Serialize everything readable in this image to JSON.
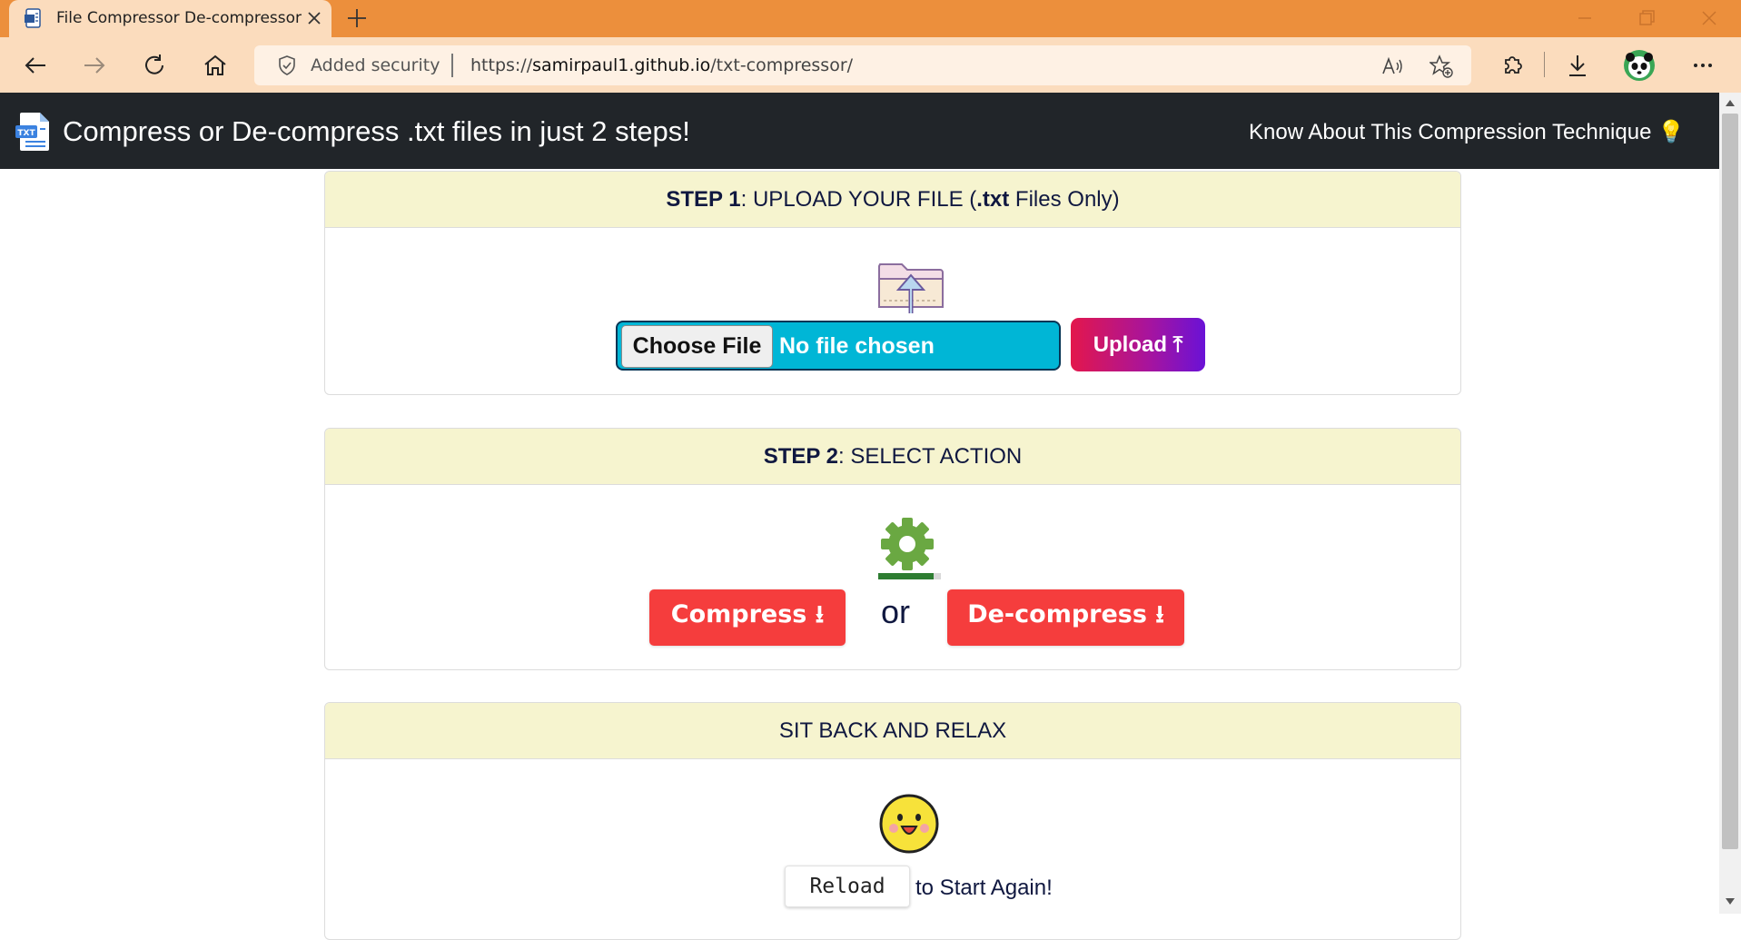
{
  "browser": {
    "tab_title": "File Compressor De-compressor",
    "address": {
      "security_label": "Added security",
      "url_prefix": "https://",
      "url_host": "samirpaul1.github.io",
      "url_path": "/txt-compressor/"
    }
  },
  "header": {
    "title": "Compress or De-compress .txt files in just 2 steps!",
    "know_link": "Know About This Compression Technique",
    "know_link_emoji": "💡"
  },
  "step1": {
    "step_label": "STEP 1",
    "title_pre": ": UPLOAD YOUR FILE (",
    "title_ext": ".txt",
    "title_post": " Files Only)",
    "choose_file_label": "Choose File",
    "file_status": "No file chosen",
    "upload_label": "Upload ⤒"
  },
  "step2": {
    "step_label": "STEP 2",
    "title_post": ": SELECT ACTION",
    "progress_fraction": 0.88,
    "compress_label": "Compress ⭳",
    "or_text": "or",
    "decompress_label": "De-compress ⭳"
  },
  "step3": {
    "title": "SIT BACK AND RELAX",
    "reload_label": "Reload",
    "start_again_text": "to Start Again!"
  },
  "colors": {
    "tabbar": "#ec8f3c",
    "toolbar": "#fbdcbd",
    "header_bg": "#212529",
    "card_head_bg": "#f6f4cf",
    "action_red": "#f53d3d",
    "file_input_bg": "#00b6d6"
  }
}
